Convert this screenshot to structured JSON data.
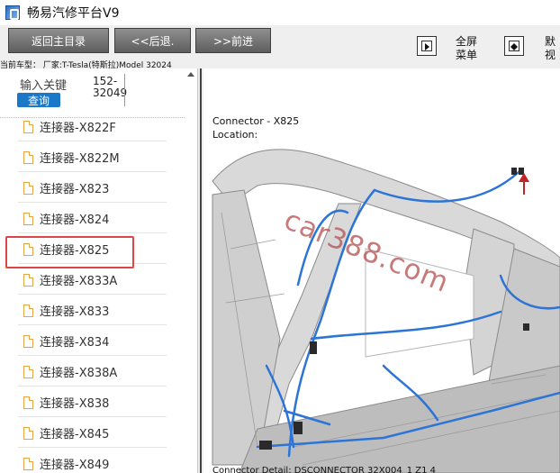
{
  "window": {
    "title": "畅易汽修平台V9"
  },
  "toolbar": {
    "home_label": "返回主目录",
    "back_label": "<<后退.",
    "forward_label": ">>前进",
    "fullscreen_label_line1": "全屏",
    "fullscreen_label_line2": "菜单",
    "default_label_line1": "默",
    "default_label_line2": "视"
  },
  "vehicle": {
    "model_line": "当前车型：  厂家:T-Tesla(特斯拉)Model 32024"
  },
  "search": {
    "label": "输入关键",
    "value": "152-32049",
    "button_label": "查询"
  },
  "list": {
    "items": [
      {
        "label": "连接器-X822F"
      },
      {
        "label": "连接器-X822M"
      },
      {
        "label": "连接器-X823"
      },
      {
        "label": "连接器-X824"
      },
      {
        "label": "连接器-X825"
      },
      {
        "label": "连接器-X833A"
      },
      {
        "label": "连接器-X833"
      },
      {
        "label": "连接器-X834"
      },
      {
        "label": "连接器-X838A"
      },
      {
        "label": "连接器-X838"
      },
      {
        "label": "连接器-X845"
      },
      {
        "label": "连接器-X849"
      }
    ],
    "selected_index": 4
  },
  "content": {
    "connector_title": "Connector - X825",
    "location_label": "Location:",
    "watermark": "car388.com",
    "bottom_caption": "Connector Detail: DSCONNECTOR 32X004_1 Z1 4"
  },
  "colors": {
    "accent": "#1a78c9",
    "highlight": "#e04545",
    "harness": "#2c74d6"
  }
}
